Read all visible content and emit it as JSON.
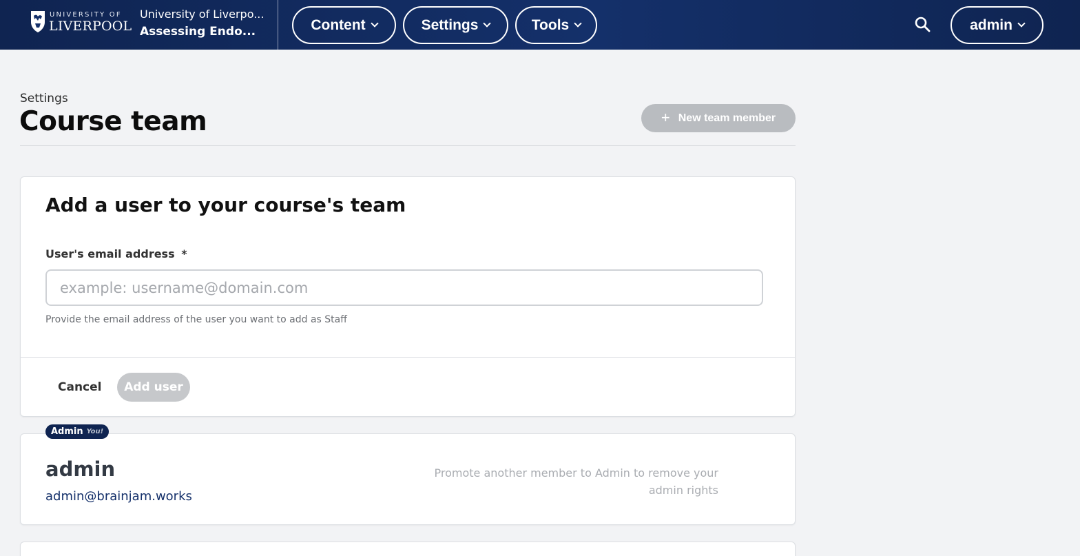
{
  "header": {
    "logo": {
      "line1": "UNIVERSITY OF",
      "line2": "LIVERPOOL"
    },
    "org_name": "University of Liverpo...",
    "course_title": "Assessing Endo...",
    "nav": [
      {
        "label": "Content"
      },
      {
        "label": "Settings"
      },
      {
        "label": "Tools"
      }
    ],
    "user_menu_label": "admin",
    "search_icon": "search-icon"
  },
  "page": {
    "breadcrumb": "Settings",
    "title": "Course team",
    "new_member_button": "New team member"
  },
  "add_user_form": {
    "heading": "Add a user to your course's team",
    "email_label": "User's email address",
    "required_marker": "*",
    "email_value": "",
    "email_placeholder": "example: username@domain.com",
    "help_text": "Provide the email address of the user you want to add as Staff",
    "cancel_label": "Cancel",
    "submit_label": "Add user"
  },
  "members": [
    {
      "role": "Admin",
      "you_label": "You!",
      "name": "admin",
      "email": "admin@brainjam.works",
      "note": "Promote another member to Admin to remove your admin rights"
    }
  ],
  "colors": {
    "header_bg": "#0f2451",
    "accent": "#14306a",
    "disabled_button": "#b9bcc0"
  }
}
